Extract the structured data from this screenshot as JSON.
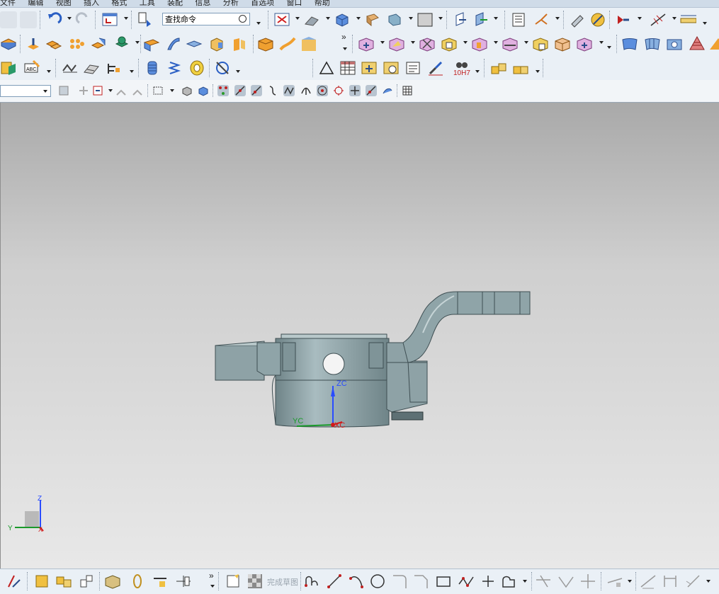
{
  "menubar": {
    "items": [
      "文件",
      "编辑",
      "视图",
      "插入",
      "格式",
      "工具",
      "装配",
      "信息",
      "分析",
      "首选项",
      "窗口",
      "帮助"
    ]
  },
  "toolbar_top": {
    "search": {
      "value": "查找命令"
    },
    "icons": [
      "copy-icon",
      "paste-icon",
      "undo-icon",
      "redo-icon",
      "start-menu-icon",
      "command-finder-icon",
      "fit-view-icon",
      "orient-view-icon",
      "shaded-view-icon",
      "edge-display-icon",
      "section-icon",
      "background-icon",
      "wcs-icon",
      "dynamic-wcs-icon",
      "layer-settings-icon",
      "datum-csys-icon",
      "point-icon",
      "sketch-plane-icon",
      "measure-distance-icon",
      "measure-body-icon"
    ]
  },
  "toolbar_feature": {
    "icons": [
      "extrude-icon",
      "revolve-icon",
      "pattern-icon",
      "unite-icon",
      "hole-icon",
      "shell-icon",
      "draft-icon",
      "edge-blend-icon",
      "chamfer-icon",
      "trim-body-icon",
      "offset-face-icon",
      "sweep-icon",
      "surface-icon",
      "move-face-icon",
      "replace-face-icon",
      "delete-face-icon",
      "resize-face-icon",
      "pull-face-icon",
      "offset-region-icon",
      "synchronous-icon",
      "studio-surface-icon",
      "through-curves-icon",
      "ruled-icon",
      "n-sided-icon"
    ]
  },
  "toolbar_pmi": {
    "icons": [
      "reuse-library-icon",
      "text-note-icon",
      "weld-icon",
      "thread-icon",
      "gear-icon",
      "coil-spring-icon",
      "bearing-icon",
      "harness-icon",
      "datum-feature-icon",
      "table-icon",
      "cad-annotation-icon",
      "view-manager-icon",
      "note-icon",
      "brush-icon",
      "dimension-icon",
      "tolerance-fit-icon",
      "assembly-icon",
      "component-icon"
    ],
    "fit_label": "10H7"
  },
  "selection_bar": {
    "filter_value": "",
    "icons": [
      "select-all-icon",
      "snap-icon",
      "filter-icon",
      "lock-icon",
      "rectangle-select-icon",
      "solid-body-icon",
      "face-icon",
      "endpoint-snap-icon",
      "midpoint-snap-icon",
      "line-snap-icon",
      "curve-snap-icon",
      "control-point-icon",
      "arc-center-icon",
      "quadrant-icon",
      "intersection-icon",
      "tangent-icon",
      "point-on-surface-icon",
      "grid-icon"
    ]
  },
  "viewport": {
    "part_label": "",
    "csys_labels": {
      "zc": "ZC",
      "yc": "YC",
      "xc": "XC"
    },
    "triad_labels": {
      "z": "Z",
      "y": "Y",
      "x": "X"
    }
  },
  "bottom_toolbar": {
    "finish_sketch_label": "完成草图",
    "icons": [
      "sketch-in-task-icon",
      "sketch-curve-icon",
      "profile-icon",
      "line-icon",
      "arc-icon",
      "circle-icon",
      "fillet-icon",
      "chamfer-sketch-icon",
      "rectangle-icon",
      "polygon-icon",
      "studio-spline-icon",
      "point-sketch-icon",
      "offset-curve-icon",
      "pattern-curve-icon",
      "mirror-curve-icon",
      "trim-icon",
      "extend-icon",
      "make-corner-icon",
      "constraint-icon",
      "dimension-icon"
    ]
  },
  "colors": {
    "part_body": "#8fa4a8",
    "part_shadow": "#5e7074",
    "zc_axis": "#2a4cff",
    "yc_axis": "#1a9a2a",
    "xc_axis": "#d21a1a",
    "toolbar_bg": "#eaf0f6"
  }
}
